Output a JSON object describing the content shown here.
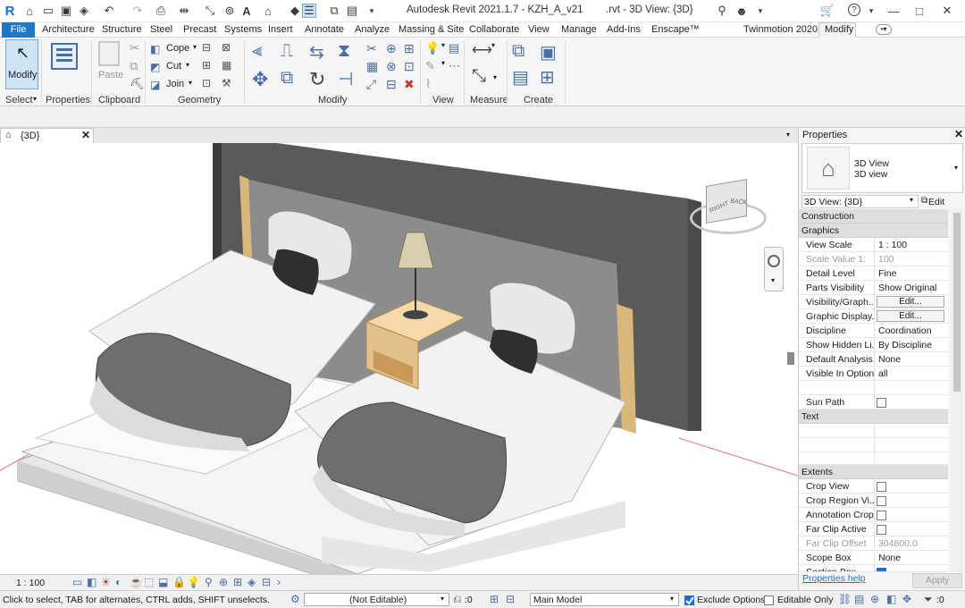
{
  "window": {
    "app_title": "Autodesk Revit 2021.1.7 - KZH_A_v21",
    "doc_title": ".rvt - 3D View: {3D}"
  },
  "menu": {
    "tabs": [
      "File",
      "Architecture",
      "Structure",
      "Steel",
      "Precast",
      "Systems",
      "Insert",
      "Annotate",
      "Analyze",
      "Massing & Site",
      "Collaborate",
      "View",
      "Manage",
      "Add-Ins",
      "Enscape™",
      "Twinmotion 2020",
      "Modify"
    ],
    "active": "Modify"
  },
  "ribbon": {
    "modify_label": "Modify",
    "groups": {
      "select": "Select",
      "properties": "Properties",
      "clipboard": "Clipboard",
      "geometry": "Geometry",
      "modify": "Modify",
      "view": "View",
      "measure": "Measure",
      "create": "Create"
    },
    "paste": "Paste",
    "cope": "Cope",
    "cut": "Cut",
    "join": "Join"
  },
  "view_tab": {
    "title": "{3D}"
  },
  "view_cube": {
    "right": "RIGHT",
    "back": "BACK"
  },
  "view_control_bar": {
    "scale": "1 : 100"
  },
  "status_bar": {
    "hint": "Click to select, TAB for alternates, CTRL adds, SHIFT unselects.",
    "editable": "(Not Editable)",
    "count": ":0",
    "model": "Main Model",
    "exclude_options": "Exclude Options",
    "editable_only": "Editable Only",
    "filter_count": ":0"
  },
  "properties": {
    "panel_title": "Properties",
    "type_name": "3D View",
    "type_sub": "3D view",
    "selector": "3D View: {3D}",
    "edit_type": "Edit Type",
    "sections": {
      "construction": "Construction",
      "graphics": "Graphics",
      "text": "Text",
      "extents": "Extents"
    },
    "graphics_rows": [
      {
        "key": "View Scale",
        "value": "1 : 100"
      },
      {
        "key": "Scale Value   1:",
        "value": "100"
      },
      {
        "key": "Detail Level",
        "value": "Fine"
      },
      {
        "key": "Parts Visibility",
        "value": "Show Original"
      },
      {
        "key": "Visibility/Graph...",
        "value": "Edit..."
      },
      {
        "key": "Graphic Display...",
        "value": "Edit..."
      },
      {
        "key": "Discipline",
        "value": "Coordination"
      },
      {
        "key": "Show Hidden Li...",
        "value": "By Discipline"
      },
      {
        "key": "Default Analysis...",
        "value": "None"
      },
      {
        "key": "Visible In Option",
        "value": "all"
      },
      {
        "key": "Sun Path",
        "value": ""
      }
    ],
    "extents_rows": [
      {
        "key": "Crop View",
        "value": ""
      },
      {
        "key": "Crop Region Vi...",
        "value": ""
      },
      {
        "key": "Annotation Crop",
        "value": ""
      },
      {
        "key": "Far Clip Active",
        "value": ""
      },
      {
        "key": "Far Clip Offset",
        "value": "304800.0"
      },
      {
        "key": "Scope Box",
        "value": "None"
      },
      {
        "key": "Section Box",
        "value": ""
      }
    ],
    "help": "Properties help",
    "apply": "Apply"
  }
}
